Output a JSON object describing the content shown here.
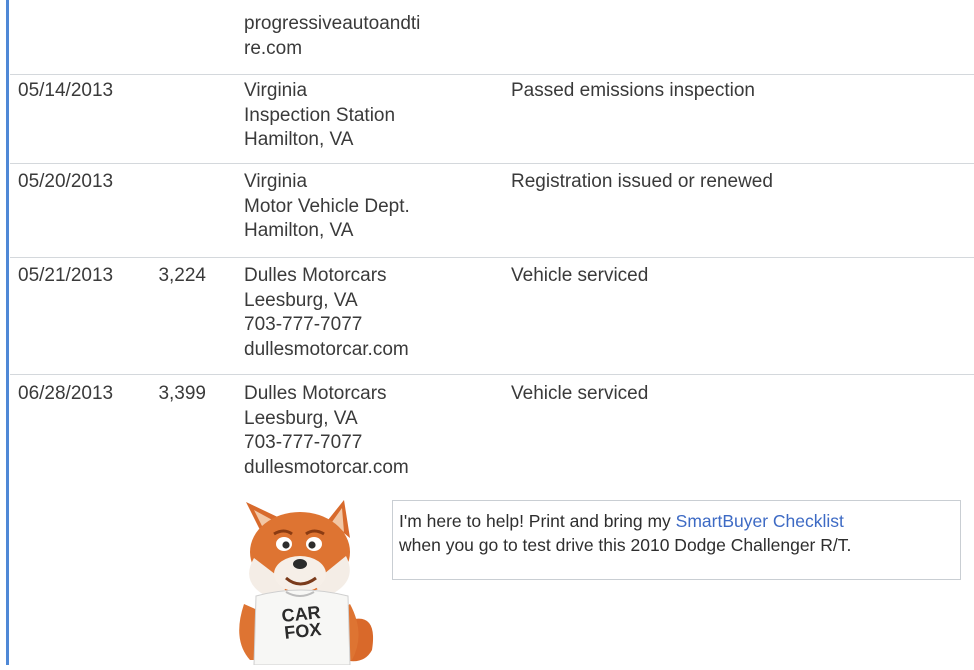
{
  "rows": [
    {
      "date": "",
      "odometer": "",
      "source": [
        "progressiveautoandti",
        "re.com"
      ],
      "detail": ""
    },
    {
      "date": "05/14/2013",
      "odometer": "",
      "source": [
        "Virginia",
        "Inspection Station",
        "Hamilton, VA"
      ],
      "detail": "Passed emissions inspection"
    },
    {
      "date": "05/20/2013",
      "odometer": "",
      "source": [
        "Virginia",
        "Motor Vehicle Dept.",
        "Hamilton, VA"
      ],
      "detail": "Registration issued or renewed"
    },
    {
      "date": "05/21/2013",
      "odometer": "3,224",
      "source": [
        "Dulles Motorcars",
        "Leesburg, VA",
        "703-777-7077",
        "dullesmotorcar.com"
      ],
      "detail": "Vehicle serviced"
    },
    {
      "date": "06/28/2013",
      "odometer": "3,399",
      "source": [
        "Dulles Motorcars",
        "Leesburg, VA",
        "703-777-7077",
        "dullesmotorcar.com"
      ],
      "detail": "Vehicle serviced"
    }
  ],
  "tip": {
    "before_link": "I'm here to help! Print and bring my ",
    "link": "SmartBuyer Checklist",
    "after_link": "when you go to test drive this 2010 Dodge Challenger R/T."
  },
  "mascot": {
    "shirt_text": [
      "CAR",
      "FOX"
    ],
    "icon": "carfox-mascot-icon"
  },
  "colors": {
    "accent_rule": "#4f88d6",
    "link": "#3d6ac4",
    "row_divider": "#d4d8dc"
  }
}
